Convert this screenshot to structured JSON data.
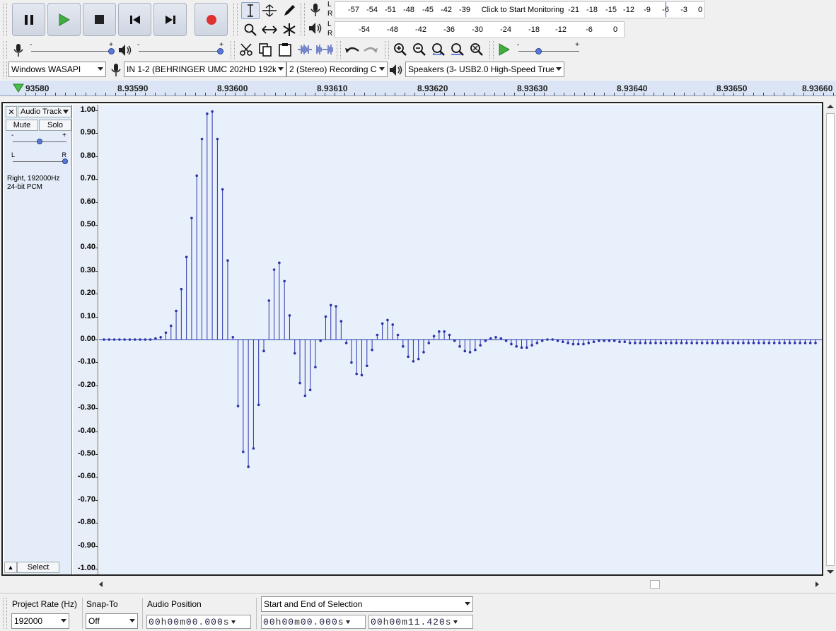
{
  "transport": {
    "pause": "pause-icon",
    "play": "play-icon",
    "stop": "stop-icon",
    "skip_start": "skip-to-start-icon",
    "skip_end": "skip-to-end-icon",
    "record": "record-icon"
  },
  "record_meter": {
    "L": "L",
    "R": "R",
    "ticks": [
      "-57",
      "-54",
      "-51",
      "-48",
      "-45",
      "-42",
      "-39",
      "Click to Start Monitoring",
      "-21",
      "-18",
      "-15",
      "-12",
      "-9",
      "-6",
      "-3",
      "0"
    ]
  },
  "play_meter": {
    "L": "L",
    "R": "R",
    "ticks": [
      "-54",
      "-48",
      "-42",
      "-36",
      "-30",
      "-24",
      "-18",
      "-12",
      "-6",
      "0"
    ]
  },
  "mixer": {
    "rec_minus": "-",
    "rec_plus": "+",
    "play_minus": "-",
    "play_plus": "+"
  },
  "play_at_speed": {
    "minus": "-",
    "plus": "+"
  },
  "device": {
    "host": "Windows WASAPI",
    "input": "IN 1-2 (BEHRINGER UMC 202HD 192k)",
    "channels": "2 (Stereo) Recording C",
    "output": "Speakers (3- USB2.0 High-Speed True I"
  },
  "ruler": {
    "labels": [
      "93580",
      "8.93590",
      "8.93600",
      "8.93610",
      "8.93620",
      "8.93630",
      "8.93640",
      "8.93650",
      "8.93660"
    ]
  },
  "track": {
    "close": "✕",
    "name": "Audio Track",
    "mute": "Mute",
    "solo": "Solo",
    "gain_minus": "-",
    "gain_plus": "+",
    "pan_left": "L",
    "pan_right": "R",
    "info1": "Right, 192000Hz",
    "info2": "24-bit PCM",
    "select": "Select",
    "collapse": "▲"
  },
  "vruler": {
    "labels": [
      "1.00",
      "0.90",
      "0.80",
      "0.70",
      "0.60",
      "0.50",
      "0.40",
      "0.30",
      "0.20",
      "0.10",
      "0.00",
      "-0.10",
      "-0.20",
      "-0.30",
      "-0.40",
      "-0.50",
      "-0.60",
      "-0.70",
      "-0.80",
      "-0.90",
      "-1.00"
    ]
  },
  "samples": [
    0,
    0,
    0,
    0,
    0,
    0,
    0,
    0,
    0,
    0,
    0.005,
    0.01,
    0.03,
    0.06,
    0.125,
    0.22,
    0.36,
    0.53,
    0.715,
    0.875,
    0.985,
    0.995,
    0.875,
    0.655,
    0.345,
    0.01,
    -0.29,
    -0.49,
    -0.555,
    -0.475,
    -0.285,
    -0.05,
    0.17,
    0.305,
    0.335,
    0.255,
    0.105,
    -0.06,
    -0.19,
    -0.245,
    -0.22,
    -0.12,
    -0.005,
    0.1,
    0.15,
    0.145,
    0.08,
    -0.015,
    -0.1,
    -0.15,
    -0.155,
    -0.115,
    -0.045,
    0.02,
    0.07,
    0.085,
    0.065,
    0.02,
    -0.03,
    -0.075,
    -0.095,
    -0.085,
    -0.055,
    -0.015,
    0.015,
    0.035,
    0.035,
    0.02,
    -0.005,
    -0.03,
    -0.05,
    -0.055,
    -0.045,
    -0.025,
    -0.005,
    0.005,
    0.01,
    0.005,
    -0.005,
    -0.02,
    -0.03,
    -0.035,
    -0.035,
    -0.025,
    -0.015,
    -0.005,
    0,
    0,
    -0.005,
    -0.01,
    -0.015,
    -0.02,
    -0.02,
    -0.02,
    -0.015,
    -0.01,
    -0.005,
    -0.005,
    -0.005,
    -0.005,
    -0.01,
    -0.01,
    -0.015,
    -0.015,
    -0.015,
    -0.015,
    -0.015,
    -0.015,
    -0.015,
    -0.015,
    -0.015,
    -0.015,
    -0.015,
    -0.015,
    -0.015,
    -0.015,
    -0.015,
    -0.015,
    -0.015,
    -0.015,
    -0.015,
    -0.015,
    -0.015,
    -0.015,
    -0.015,
    -0.015,
    -0.015,
    -0.015,
    -0.015,
    -0.015,
    -0.015,
    -0.015,
    -0.015,
    -0.015,
    -0.015,
    -0.015,
    -0.015,
    -0.015,
    -0.015,
    -0.015
  ],
  "selection_bar": {
    "project_rate_label": "Project Rate (Hz)",
    "project_rate": "192000",
    "snap_label": "Snap-To",
    "snap": "Off",
    "audio_pos_label": "Audio Position",
    "audio_pos": [
      "0",
      "0",
      "h",
      "0",
      "0",
      "m",
      "0",
      "0",
      ".",
      "0",
      "0",
      "0",
      "s"
    ],
    "selection_mode": "Start and End of Selection",
    "sel_start": [
      "0",
      "0",
      "h",
      "0",
      "0",
      "m",
      "0",
      "0",
      ".",
      "0",
      "0",
      "0",
      "s"
    ],
    "sel_end": [
      "0",
      "0",
      "h",
      "0",
      "0",
      "m",
      "1",
      "1",
      ".",
      "4",
      "2",
      "0",
      "s"
    ]
  },
  "colors": {
    "waveform": "#2a33a8",
    "record": "#e03030",
    "play": "#3a9a3a",
    "wave_bg": "#e8f0fc"
  }
}
